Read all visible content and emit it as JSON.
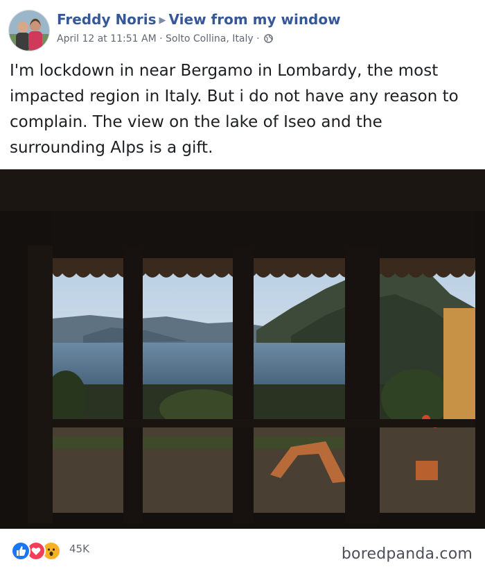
{
  "post": {
    "author": "Freddy Noris",
    "group": "View from my window",
    "date": "April 12 at 11:51 AM",
    "separator": "·",
    "location": "Solto Collina, Italy ·",
    "privacy_icon": "globe-icon",
    "text": "I'm lockdown in near Bergamo in Lombardy, the most impacted region in Italy. But i do not have any reason to complain. The view on the lake of Iseo and the surrounding Alps is a gift."
  },
  "reactions": {
    "icons": [
      "like-icon",
      "love-icon",
      "wow-icon"
    ],
    "count": "45K"
  },
  "watermark": "boredpanda.com",
  "colors": {
    "link": "#365899",
    "meta": "#616770",
    "like": "#1877f2",
    "love": "#f33e58",
    "wow": "#f7b125"
  }
}
